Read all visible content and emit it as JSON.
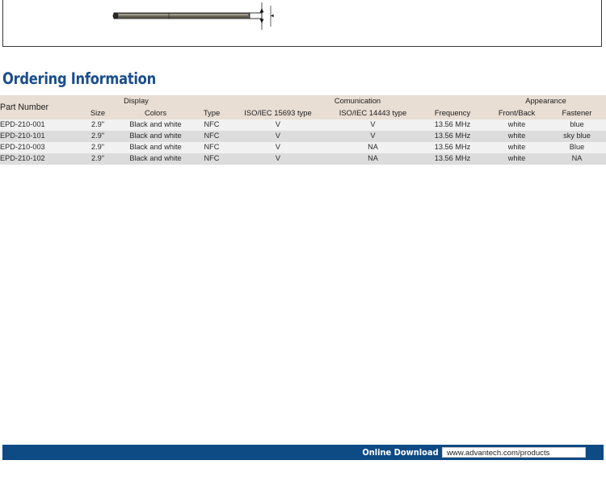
{
  "drawing": {
    "name": "side-view-dimension-drawing",
    "description": "Side profile technical drawing of a thin EPD panel with vertical dimension extension lines and arrowheads at the right edge"
  },
  "section": {
    "heading": "Ordering Information"
  },
  "table": {
    "group_headers": [
      {
        "label": "",
        "span": 1
      },
      {
        "label": "Display",
        "span": 2
      },
      {
        "label": "",
        "span": 1
      },
      {
        "label": "Comunication",
        "span": 3
      },
      {
        "label": "Appearance",
        "span": 2
      }
    ],
    "sub_headers": [
      "Part Number",
      "Size",
      "Colors",
      "Type",
      "ISO/IEC 15693 type",
      "ISO/IEC 14443 type",
      "Frequency",
      "Front/Back",
      "Fastener"
    ],
    "rows": [
      {
        "part_number": "EPD-210-001",
        "size": "2.9\"",
        "colors": "Black and white",
        "type": "NFC",
        "iso_15693": "V",
        "iso_14443": "V",
        "frequency": "13.56 MHz",
        "front_back": "white",
        "fastener": "blue"
      },
      {
        "part_number": "EPD-210-101",
        "size": "2.9\"",
        "colors": "Black and white",
        "type": "NFC",
        "iso_15693": "V",
        "iso_14443": "V",
        "frequency": "13.56 MHz",
        "front_back": "white",
        "fastener": "sky blue"
      },
      {
        "part_number": "EPD-210-003",
        "size": "2.9\"",
        "colors": "Black and white",
        "type": "NFC",
        "iso_15693": "V",
        "iso_14443": "NA",
        "frequency": "13.56 MHz",
        "front_back": "white",
        "fastener": "Blue"
      },
      {
        "part_number": "EPD-210-102",
        "size": "2.9\"",
        "colors": "Black and white",
        "type": "NFC",
        "iso_15693": "V",
        "iso_14443": "NA",
        "frequency": "13.56 MHz",
        "front_back": "white",
        "fastener": "NA"
      }
    ]
  },
  "footer": {
    "online_download_label": "Online Download",
    "url": "www.advantech.com/products"
  },
  "colors": {
    "heading_blue": "#1b4e8c",
    "footer_blue": "#0e4a84",
    "table_header_beige": "#e9ded4",
    "row_light": "#f1f1f1",
    "row_dark": "#dcdcdc"
  }
}
